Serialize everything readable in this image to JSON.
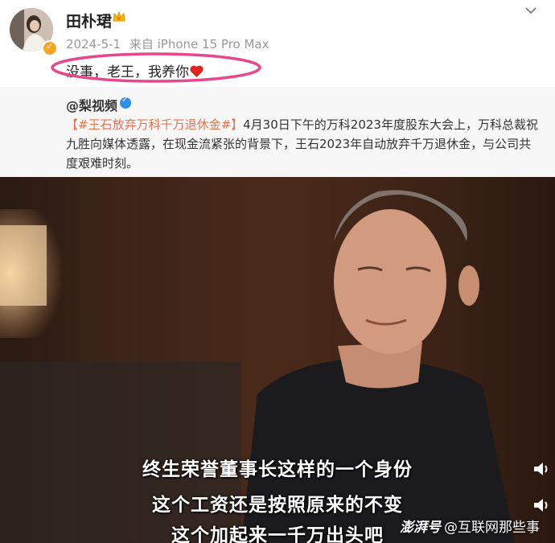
{
  "post": {
    "username": "田朴珺",
    "date": "2024-5-1",
    "source": "来自 iPhone 15 Pro Max",
    "text": "没事，老王，我养你"
  },
  "repost": {
    "author": "@梨视频",
    "hashtag": "【#王石放弃万科千万退休金#】",
    "body": "4月30日下午的万科2023年度股东大会上，万科总裁祝九胜向媒体透露，在现金流紧张的背景下，王石2023年自动放弃千万退休金，与公司共度艰难时刻。"
  },
  "video": {
    "subtitles": [
      "终生荣誉董事长这样的一个身份",
      "这个工资还是按照原来的不变",
      "这个加起来一千万出头吧"
    ],
    "watermark_brand": "澎湃号",
    "watermark_account": "@互联网那些事"
  },
  "colors": {
    "hashtag": "#eb7350",
    "highlight_oval": "#e8478c",
    "verified": "#2f8fe8",
    "vip_badge": "#f5a623"
  },
  "icons": [
    "crown-icon",
    "chevron-down-icon",
    "heart-icon",
    "verified-icon",
    "speaker-icon"
  ]
}
